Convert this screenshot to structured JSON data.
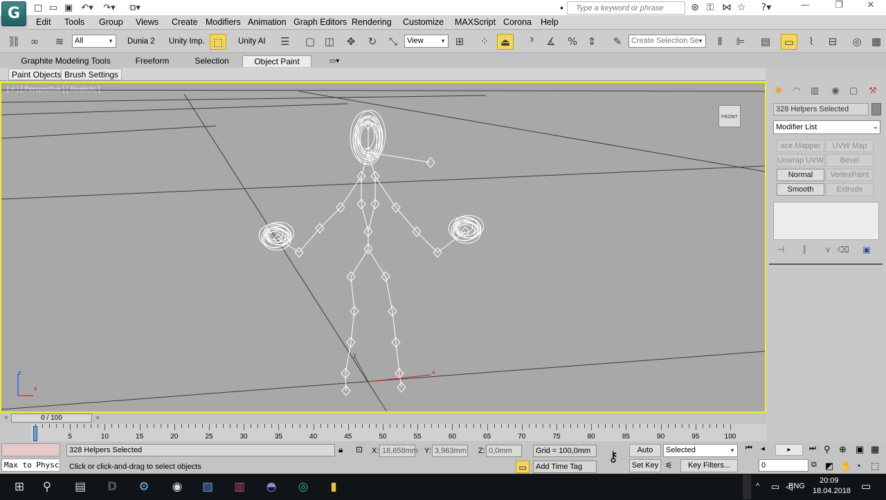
{
  "titlebar": {
    "logo": "G",
    "search_placeholder": "Type a keyword or phrase",
    "icons": [
      "new-file-icon",
      "open-folder-icon",
      "save-icon",
      "undo-icon",
      "redo-icon",
      "project-folder-icon",
      "binoculars-icon",
      "key-icon",
      "star-icon",
      "help-icon"
    ]
  },
  "menu": {
    "items": [
      "Edit",
      "Tools",
      "Group",
      "Views",
      "Create",
      "Modifiers",
      "Animation",
      "Graph Editors",
      "Rendering",
      "Customize",
      "MAXScript",
      "Corona",
      "Help"
    ]
  },
  "toolbar": {
    "selection_filter": "All",
    "dunia_label": "Dunia 2",
    "unity_imp_label": "Unity Imp.",
    "unity_ai_label": "Unity AI",
    "ref_coord": "View",
    "named_selection_placeholder": "Create Selection Se"
  },
  "ribbon": {
    "tabs": [
      "Graphite Modeling Tools",
      "Freeform",
      "Selection",
      "Object Paint"
    ],
    "active_tab": "Object Paint",
    "subtabs": [
      "Paint Objects",
      "Brush Settings"
    ]
  },
  "viewport": {
    "label": "[ + ] [ Perspective ] [ Realistic ]",
    "viewcube_label": "FRONT",
    "axis_x": "x",
    "axis_y": "y",
    "axis_z": "z",
    "border_color": "#f2ec2a",
    "background_color": "#a8a8a8"
  },
  "command_panel": {
    "selection_count": "328 Helpers Selected",
    "modifier_list": "Modifier List",
    "modifier_buttons": [
      {
        "label": "ace Mapper (W",
        "enabled": false
      },
      {
        "label": "UVW Map",
        "enabled": false
      },
      {
        "label": "Unwrap UVW",
        "enabled": false
      },
      {
        "label": "Bevel",
        "enabled": false
      },
      {
        "label": "Normal",
        "enabled": true
      },
      {
        "label": "VertexPaint",
        "enabled": false
      },
      {
        "label": "Smooth",
        "enabled": true
      },
      {
        "label": "Extrude",
        "enabled": false
      }
    ]
  },
  "timeline": {
    "slider_text": "0 / 100",
    "current_frame": 0,
    "frame_min": 0,
    "frame_max": 100,
    "tick_labels": [
      "0",
      "5",
      "10",
      "15",
      "20",
      "25",
      "30",
      "35",
      "40",
      "45",
      "50",
      "55",
      "60",
      "65",
      "70",
      "75",
      "80",
      "85",
      "90",
      "95",
      "100"
    ]
  },
  "status": {
    "maxscript_text": "Max to Physc",
    "selection_text": "328 Helpers Selected",
    "prompt_text": "Click or click-and-drag to select objects",
    "x_label": "X:",
    "x_value": "18,658mm",
    "y_label": "Y:",
    "y_value": "3,963mm",
    "z_label": "Z:",
    "z_value": "0,0mm",
    "grid_text": "Grid = 100,0mm",
    "add_time_tag": "Add Time Tag",
    "auto_key": "Auto Key",
    "set_key": "Set Key",
    "key_mode": "Selected",
    "key_filters": "Key Filters...",
    "frame_field": "0"
  },
  "taskbar": {
    "language": "ENG",
    "time": "20:09",
    "date": "18.04.2018"
  }
}
